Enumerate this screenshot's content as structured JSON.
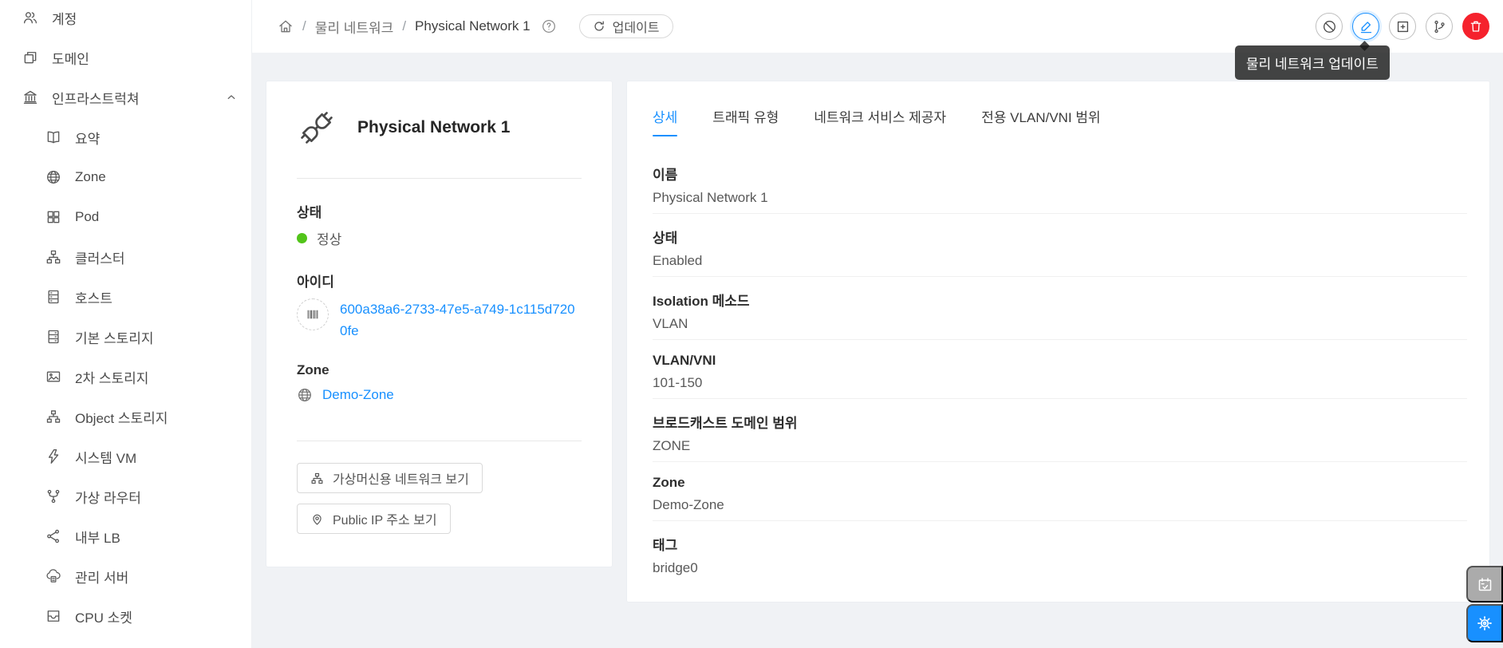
{
  "sidebar": {
    "items": [
      {
        "label": "계정"
      },
      {
        "label": "도메인"
      },
      {
        "label": "인프라스트럭쳐"
      },
      {
        "label": "요약"
      },
      {
        "label": "Zone"
      },
      {
        "label": "Pod"
      },
      {
        "label": "클러스터"
      },
      {
        "label": "호스트"
      },
      {
        "label": "기본 스토리지"
      },
      {
        "label": "2차 스토리지"
      },
      {
        "label": "Object 스토리지"
      },
      {
        "label": "시스템 VM"
      },
      {
        "label": "가상 라우터"
      },
      {
        "label": "내부 LB"
      },
      {
        "label": "관리 서버"
      },
      {
        "label": "CPU 소켓"
      }
    ]
  },
  "breadcrumb": {
    "section": "물리 네트워크",
    "current": "Physical Network 1"
  },
  "header": {
    "update_label": "업데이트",
    "tooltip": "물리 네트워크 업데이트"
  },
  "resource": {
    "title": "Physical Network 1",
    "status_label": "상태",
    "status_value": "정상",
    "id_label": "아이디",
    "id_value": "600a38a6-2733-47e5-a749-1c115d7200fe",
    "zone_label": "Zone",
    "zone_value": "Demo-Zone",
    "btn_vm_networks": "가상머신용 네트워크 보기",
    "btn_public_ip": "Public IP 주소 보기"
  },
  "tabs": [
    {
      "label": "상세"
    },
    {
      "label": "트래픽 유형"
    },
    {
      "label": "네트워크 서비스 제공자"
    },
    {
      "label": "전용 VLAN/VNI 범위"
    }
  ],
  "details": [
    {
      "label": "이름",
      "value": "Physical Network 1"
    },
    {
      "label": "상태",
      "value": "Enabled"
    },
    {
      "label": "Isolation 메소드",
      "value": "VLAN"
    },
    {
      "label": "VLAN/VNI",
      "value": "101-150"
    },
    {
      "label": "브로드캐스트 도메인 범위",
      "value": "ZONE"
    },
    {
      "label": "Zone",
      "value": "Demo-Zone"
    },
    {
      "label": "태그",
      "value": "bridge0"
    }
  ],
  "colors": {
    "primary": "#1890ff",
    "success": "#52c41a",
    "danger": "#f5222d",
    "background": "#f0f2f5"
  }
}
